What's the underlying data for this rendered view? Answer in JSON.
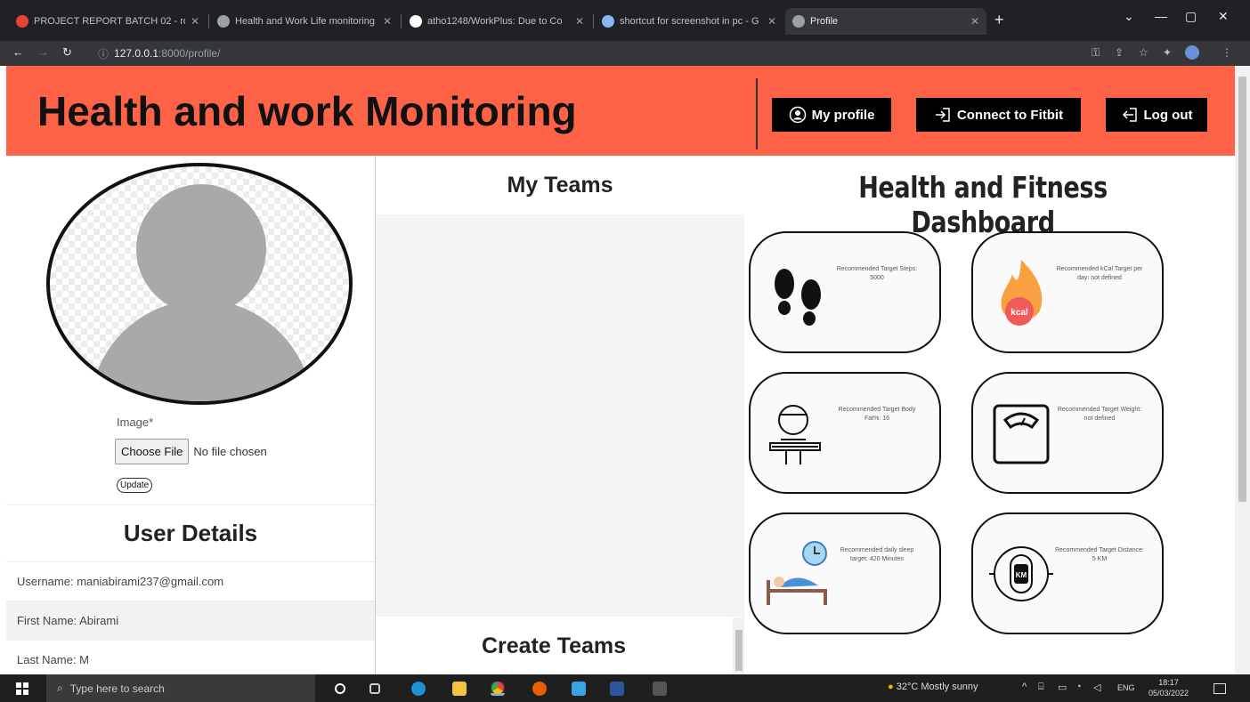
{
  "browser": {
    "tabs": [
      {
        "title": "PROJECT REPORT BATCH 02 - ro",
        "color": "#ea4335"
      },
      {
        "title": "Health and Work Life monitoring",
        "color": "#9aa0a6"
      },
      {
        "title": "atho1248/WorkPlus: Due to Co",
        "color": "#ffffff"
      },
      {
        "title": "shortcut for screenshot in pc - G",
        "color": "#8ab4f8"
      },
      {
        "title": "Profile",
        "color": "#9aa0a6"
      }
    ],
    "url_host": "127.0.0.1",
    "url_path": ":8000/profile/"
  },
  "header": {
    "title": "Health and work Monitoring",
    "my_profile": "My profile",
    "connect_fitbit": "Connect to Fitbit",
    "log_out": "Log out"
  },
  "profile": {
    "image_label": "Image*",
    "choose_file": "Choose File",
    "no_file": "No file chosen",
    "update": "Update",
    "user_details_title": "User Details",
    "username": "Username: maniabirami237@gmail.com",
    "first_name": "First Name: Abirami",
    "last_name": "Last Name: M"
  },
  "teams": {
    "my_teams": "My Teams",
    "create_teams": "Create Teams"
  },
  "dashboard": {
    "title": "Health and Fitness Dashboard",
    "cards": [
      {
        "icon": "footsteps-icon",
        "text": "Recommended Target Steps: 5000"
      },
      {
        "icon": "kcal-flame-icon",
        "text": "Recommended kCal Target per day: not defined"
      },
      {
        "icon": "body-fat-icon",
        "text": "Recommended Target Body Fat%: 16"
      },
      {
        "icon": "weight-scale-icon",
        "text": "Recommended Target Weight: not defined"
      },
      {
        "icon": "sleep-icon",
        "text": "Recommended daily sleep target: 420 Minutes"
      },
      {
        "icon": "distance-km-icon",
        "text": "Recommended Target Distance: 5 KM"
      }
    ]
  },
  "taskbar": {
    "search_placeholder": "Type here to search",
    "weather": "32°C  Mostly sunny",
    "lang": "ENG",
    "time": "18:17",
    "date": "05/03/2022"
  },
  "colors": {
    "header_bg": "#ff6347",
    "button_bg": "#000000"
  }
}
